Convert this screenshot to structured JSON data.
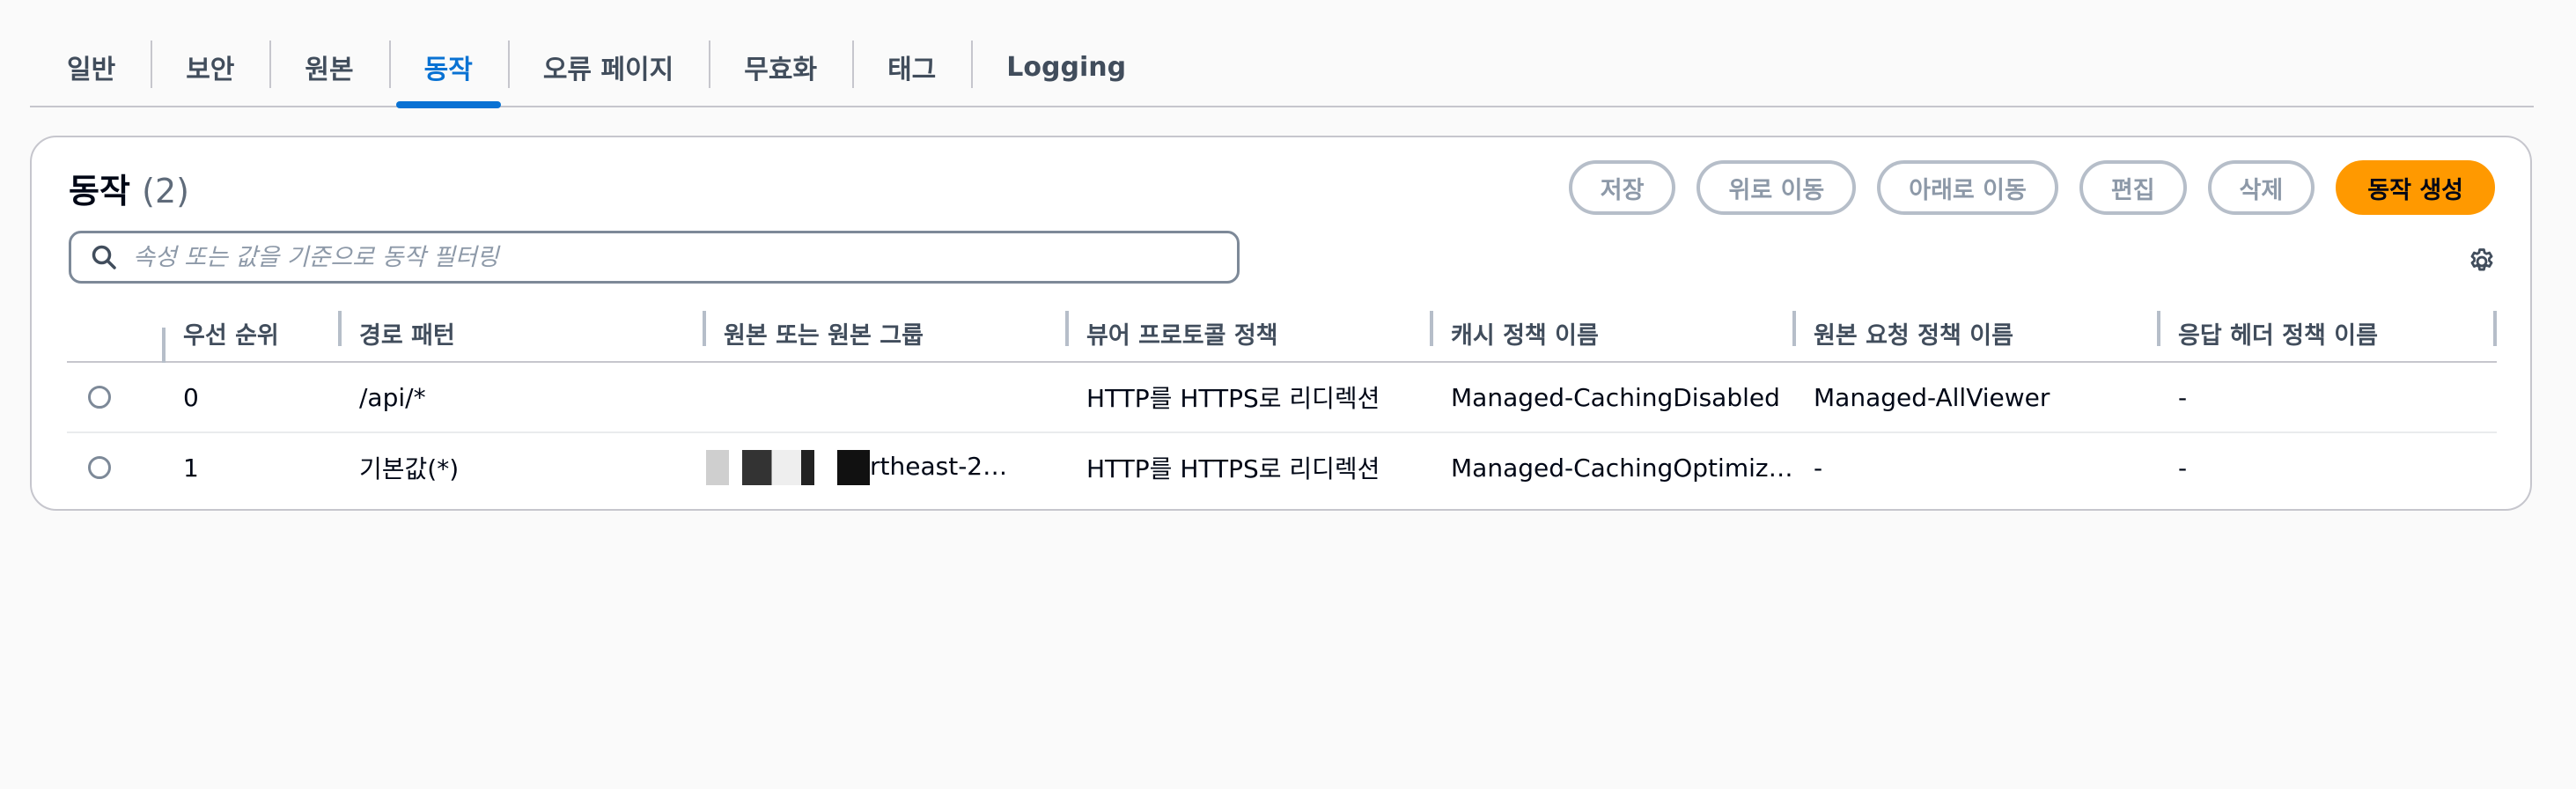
{
  "tabs": [
    {
      "label": "일반",
      "active": false
    },
    {
      "label": "보안",
      "active": false
    },
    {
      "label": "원본",
      "active": false
    },
    {
      "label": "동작",
      "active": true
    },
    {
      "label": "오류 페이지",
      "active": false
    },
    {
      "label": "무효화",
      "active": false
    },
    {
      "label": "태그",
      "active": false
    },
    {
      "label": "Logging",
      "active": false
    }
  ],
  "panel": {
    "title": "동작",
    "count": "(2)",
    "buttons": {
      "save": "저장",
      "move_up": "위로 이동",
      "move_down": "아래로 이동",
      "edit": "편집",
      "delete": "삭제",
      "create": "동작 생성"
    },
    "search_placeholder": "속성 또는 값을 기준으로 동작 필터링"
  },
  "table": {
    "headers": [
      "우선 순위",
      "경로 패턴",
      "원본 또는 원본 그룹",
      "뷰어 프로토콜 정책",
      "캐시 정책 이름",
      "원본 요청 정책 이름",
      "응답 헤더 정책 이름"
    ],
    "rows": [
      {
        "priority": "0",
        "path": "/api/*",
        "origin": "",
        "viewer": "HTTP를 HTTPS로 리디렉션",
        "cache": "Managed-CachingDisabled",
        "origin_req": "Managed-AllViewer",
        "resp": "-"
      },
      {
        "priority": "1",
        "path": "기본값(*)",
        "origin": "rtheast-2…",
        "viewer": "HTTP를 HTTPS로 리디렉션",
        "cache": "Managed-CachingOptimized",
        "origin_req": "-",
        "resp": "-"
      }
    ]
  },
  "colors": {
    "accent": "#0972d3",
    "primary_button": "#ff9900"
  },
  "icons": [
    "search-icon",
    "gear-icon"
  ]
}
